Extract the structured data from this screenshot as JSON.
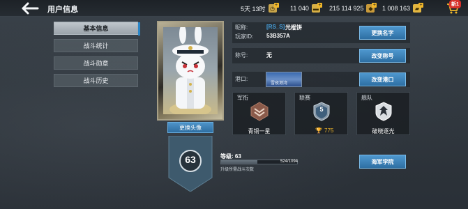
{
  "header": {
    "title": "用户信息",
    "resources": [
      {
        "value": "5天 13时",
        "icon": "clock-icon"
      },
      {
        "value": "11 040",
        "icon": "coin-icon"
      },
      {
        "value": "215 114 925",
        "icon": "silver-icon"
      },
      {
        "value": "1 008 163",
        "icon": "gold-icon"
      }
    ],
    "cart_badge": "新1"
  },
  "tabs": [
    {
      "label": "基本信息",
      "active": true
    },
    {
      "label": "战斗统计",
      "active": false
    },
    {
      "label": "战斗勋章",
      "active": false
    },
    {
      "label": "战斗历史",
      "active": false
    }
  ],
  "profile": {
    "nickname_label": "昵称:",
    "clan_tag": "[RS_S]",
    "nickname": "光棍饼",
    "player_id_label": "玩家ID:",
    "player_id": "53B357A",
    "rename_button": "更换名字",
    "title_label": "称号:",
    "title_value": "无",
    "change_title_button": "改变称号",
    "port_label": "港口:",
    "port_name": "雪夜港湾",
    "change_port_button": "改变港口",
    "change_avatar_button": "更换头像",
    "level": "63"
  },
  "cards": [
    {
      "title": "军衔",
      "value": "青铜一星",
      "icon": "rank-chevron-icon"
    },
    {
      "title": "联赛",
      "value": "775",
      "badge": "5",
      "icon": "league-badge-icon"
    },
    {
      "title": "舰队",
      "value": "破晓逐光",
      "icon": "fleet-emblem-icon"
    }
  ],
  "experience": {
    "level_label": "等级: 63",
    "progress_text": "524/1094",
    "progress": 0.479,
    "hint": "升级所需战斗次数",
    "academy_button": "海军学院"
  },
  "colors": {
    "accent": "#2e6fa3",
    "clan_tag": "#49a7e6",
    "trophy": "#f0b72a"
  }
}
